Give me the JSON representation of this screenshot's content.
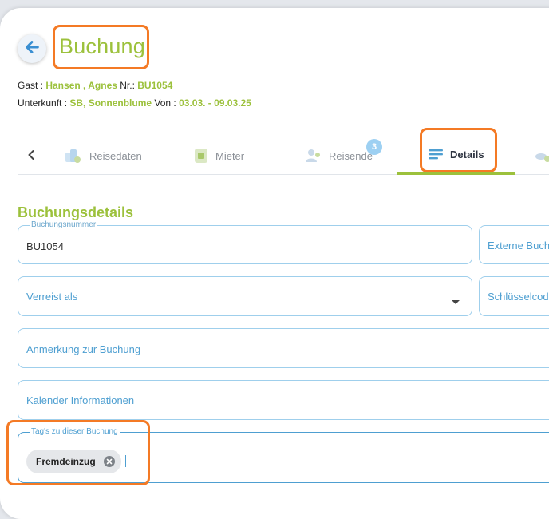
{
  "header": {
    "title": "Buchung"
  },
  "info": {
    "guest_label": "Gast : ",
    "guest_name": "Hansen , Agnes",
    "nr_label": " Nr.: ",
    "nr_value": "BU1054",
    "lodging_label": "Unterkunft : ",
    "lodging_value": "SB, Sonnenblume",
    "from_label": " Von : ",
    "date_range": "03.03. - 09.03.25"
  },
  "tabs": [
    {
      "label": "Reisedaten",
      "icon": "travel-icon"
    },
    {
      "label": "Mieter",
      "icon": "tenant-icon"
    },
    {
      "label": "Reisende",
      "icon": "travellers-icon",
      "badge": "3"
    },
    {
      "label": "Details",
      "icon": "details-icon",
      "active": true
    }
  ],
  "section": {
    "title": "Buchungsdetails"
  },
  "fields": {
    "booking_number": {
      "legend": "Buchungsnummer",
      "value": "BU1054"
    },
    "external_booking": {
      "placeholder": "Externe Buch"
    },
    "travelling_as": {
      "placeholder": "Verreist als"
    },
    "key_code": {
      "placeholder": "Schlüsselcod"
    },
    "booking_note": {
      "placeholder": "Anmerkung zur Buchung"
    },
    "calendar_info": {
      "placeholder": "Kalender Informationen"
    },
    "tags": {
      "legend": "Tag's zu dieser Buchung",
      "chips": [
        "Fremdeinzug"
      ]
    }
  },
  "colors": {
    "accent": "#9cc13c",
    "highlight": "#f47a25",
    "field_border": "#9fcfec",
    "link_blue": "#4e9fd1"
  }
}
